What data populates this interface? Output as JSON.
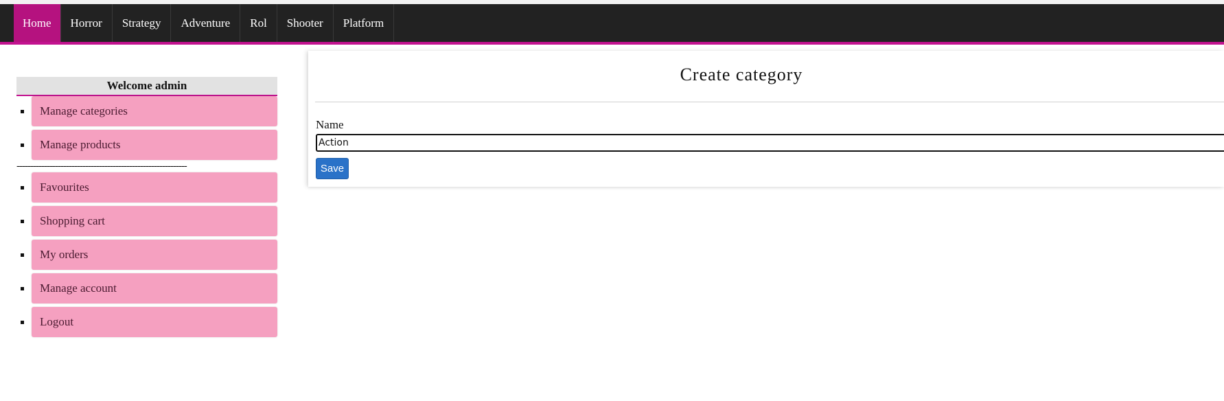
{
  "nav": {
    "items": [
      {
        "label": "Home",
        "active": true
      },
      {
        "label": "Horror"
      },
      {
        "label": "Strategy"
      },
      {
        "label": "Adventure"
      },
      {
        "label": "Rol"
      },
      {
        "label": "Shooter"
      },
      {
        "label": "Platform"
      }
    ]
  },
  "sidebar": {
    "welcome": "Welcome admin",
    "admin_items": [
      {
        "label": "Manage categories"
      },
      {
        "label": "Manage products"
      }
    ],
    "divider": "--------------------------------------------------------------",
    "user_items": [
      {
        "label": "Favourites"
      },
      {
        "label": "Shopping cart"
      },
      {
        "label": "My orders"
      },
      {
        "label": "Manage account"
      },
      {
        "label": "Logout"
      }
    ]
  },
  "main": {
    "title": "Create category",
    "name_label": "Name",
    "name_value": "Action",
    "save_label": "Save"
  },
  "colors": {
    "accent": "#c2128f",
    "nav_bg": "#222222",
    "menu_item_bg": "#f5a0c0",
    "button_blue": "#2a72c8"
  }
}
